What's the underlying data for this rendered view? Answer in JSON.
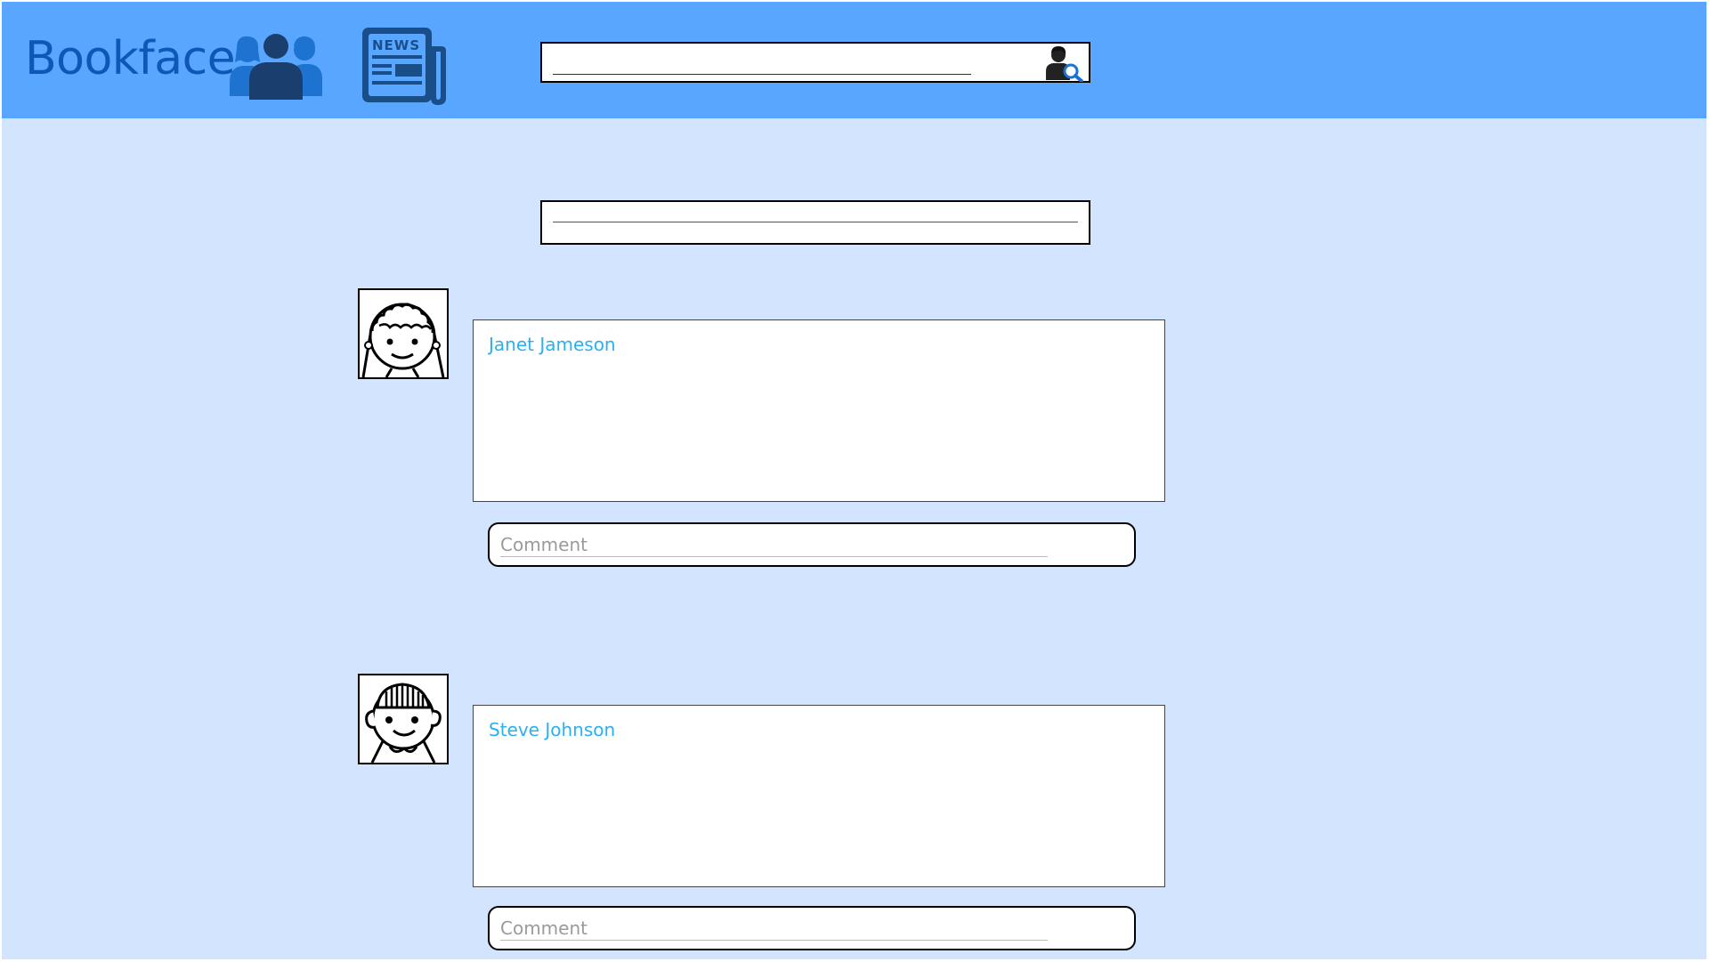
{
  "app": {
    "name": "Bookface"
  },
  "colors": {
    "header_bg": "#58a6ff",
    "page_bg": "#d3e5fe",
    "logo": "#0e57b5",
    "author_name": "#2bb0ef"
  },
  "header": {
    "nav_icons": [
      "friends-icon",
      "news-icon"
    ],
    "news_icon_label": "NEWS",
    "search": {
      "value": "",
      "placeholder": "",
      "icon": "user-search-icon"
    }
  },
  "composer": {
    "value": "",
    "placeholder": ""
  },
  "posts": [
    {
      "author": "Janet Jameson",
      "avatar": "girl-avatar-icon",
      "comment_placeholder": "Comment"
    },
    {
      "author": "Steve Johnson",
      "avatar": "boy-avatar-icon",
      "comment_placeholder": "Comment"
    }
  ]
}
